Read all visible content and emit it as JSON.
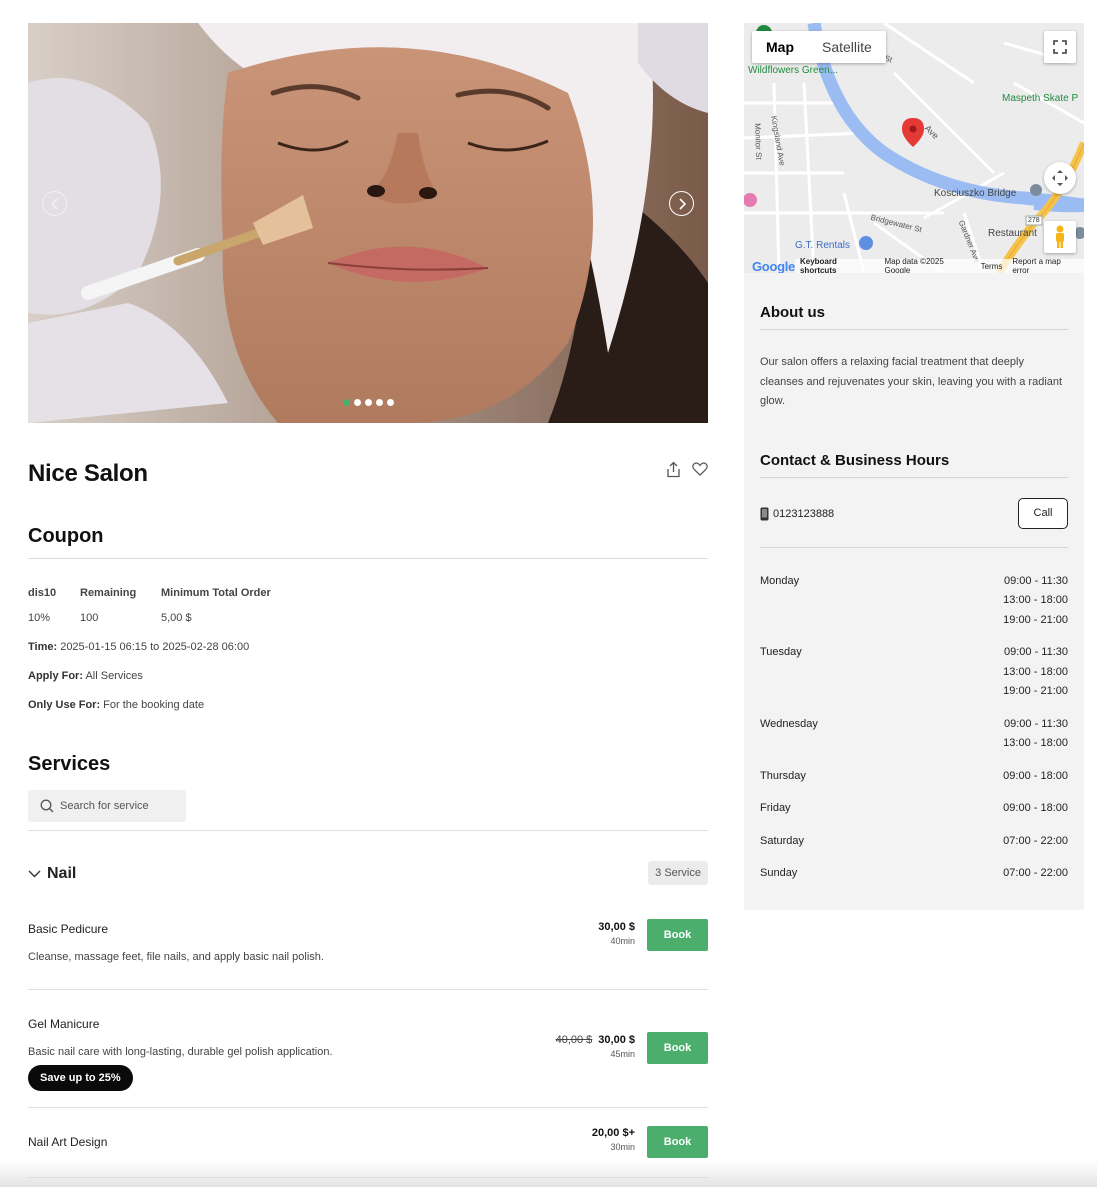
{
  "gallery": {
    "prev_icon": "chevron-left-icon",
    "next_icon": "chevron-right-icon",
    "slide_count": 5,
    "active_slide": 1,
    "accent": "#4cae6c"
  },
  "salon": {
    "name": "Nice Salon",
    "share_icon": "share-icon",
    "favorite_icon": "heart-icon"
  },
  "coupon": {
    "title": "Coupon",
    "col_code": "dis10",
    "col_remaining": "Remaining",
    "col_min_order": "Minimum Total Order",
    "discount": "10%",
    "remaining": "100",
    "min_order": "5,00 $",
    "time_label": "Time:",
    "time_value": " 2025-01-15 06:15 to 2025-02-28 06:00",
    "apply_label": "Apply For:",
    "apply_value": " All Services",
    "use_label": "Only Use For:",
    "use_value": " For the booking date"
  },
  "services": {
    "title": "Services",
    "search_placeholder": "Search for service",
    "category": {
      "name": "Nail",
      "count": "3 Service"
    },
    "items": [
      {
        "name": "Basic Pedicure",
        "description": "Cleanse, massage feet, file nails, and apply basic nail polish.",
        "price": "30,00 $",
        "old_price": "",
        "duration": "40min",
        "book_label": "Book"
      },
      {
        "name": "Gel Manicure",
        "description": "Basic nail care with long-lasting, durable gel polish application.",
        "price": "30,00 $",
        "old_price": "40,00 $",
        "duration": "45min",
        "book_label": "Book",
        "badge": "Save up to 25%"
      },
      {
        "name": "Nail Art Design",
        "description": "",
        "price": "20,00 $+",
        "old_price": "",
        "duration": "30min",
        "book_label": "Book"
      }
    ]
  },
  "map": {
    "type_map": "Map",
    "type_satellite": "Satellite",
    "labels": {
      "wildflowers": "Wildflowers Green...",
      "maspeth": "Maspeth Skate P",
      "kosciuszko": "Kosciuszko Bridge",
      "gt_rentals": "G.T. Rentals",
      "restaurant": "Restaurant",
      "monitor": "Monitor St",
      "kingsland": "Kingsland Ave",
      "bridgewater": "Bridgewater St",
      "gardner": "Gardner Ave",
      "ave": "Ave",
      "st": "th St",
      "route": "278"
    },
    "footer": {
      "logo": "Google",
      "shortcuts": "Keyboard shortcuts",
      "data": "Map data ©2025 Google",
      "terms": "Terms",
      "report": "Report a map error"
    }
  },
  "about": {
    "title": "About us",
    "text": "Our salon offers a relaxing facial treatment that deeply cleanses and rejuvenates your skin, leaving you with a radiant glow."
  },
  "contact": {
    "title": "Contact & Business Hours",
    "phone": "0123123888",
    "phone_icon": "mobile-phone-icon",
    "call_label": "Call",
    "hours": [
      {
        "day": "Monday",
        "slots": [
          "09:00 - 11:30",
          "13:00 - 18:00",
          "19:00 - 21:00"
        ]
      },
      {
        "day": "Tuesday",
        "slots": [
          "09:00 - 11:30",
          "13:00 - 18:00",
          "19:00 - 21:00"
        ]
      },
      {
        "day": "Wednesday",
        "slots": [
          "09:00 - 11:30",
          "13:00 - 18:00"
        ]
      },
      {
        "day": "Thursday",
        "slots": [
          "09:00 - 18:00"
        ]
      },
      {
        "day": "Friday",
        "slots": [
          "09:00 - 18:00"
        ]
      },
      {
        "day": "Saturday",
        "slots": [
          "07:00 - 22:00"
        ]
      },
      {
        "day": "Sunday",
        "slots": [
          "07:00 - 22:00"
        ]
      }
    ]
  }
}
